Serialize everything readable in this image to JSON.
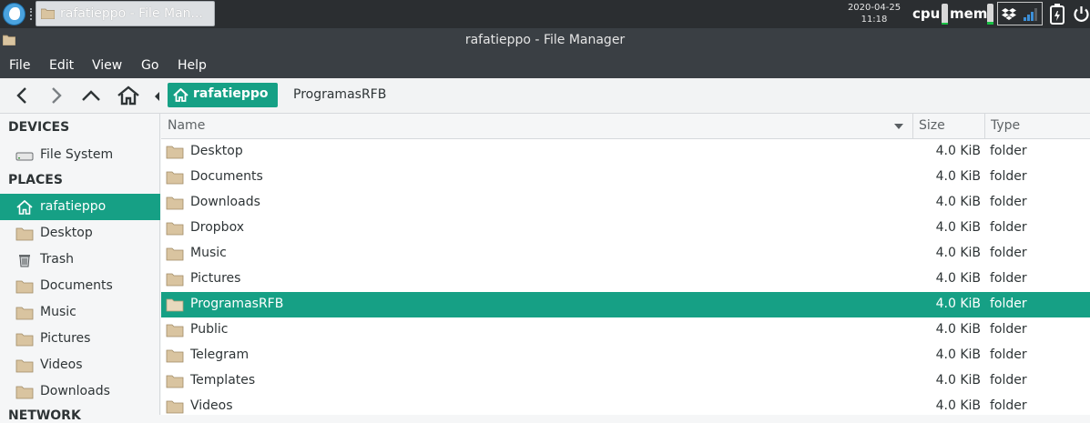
{
  "taskbar": {
    "task_label": "rafatieppo - File Man...",
    "clock_date": "2020-04-25",
    "clock_time": "11:18",
    "cpu_label": "cpu",
    "mem_label": "mem"
  },
  "window": {
    "title": "rafatieppo - File Manager"
  },
  "menu": {
    "items": [
      "File",
      "Edit",
      "View",
      "Go",
      "Help"
    ]
  },
  "path": {
    "home_label": "rafatieppo",
    "current": "ProgramasRFB"
  },
  "sidebar": {
    "devices_heading": "DEVICES",
    "devices": [
      {
        "label": "File System",
        "icon": "drive-icon"
      }
    ],
    "places_heading": "PLACES",
    "places": [
      {
        "label": "rafatieppo",
        "icon": "home-icon"
      },
      {
        "label": "Desktop",
        "icon": "folder-icon"
      },
      {
        "label": "Trash",
        "icon": "trash-icon"
      },
      {
        "label": "Documents",
        "icon": "folder-icon"
      },
      {
        "label": "Music",
        "icon": "folder-icon"
      },
      {
        "label": "Pictures",
        "icon": "folder-icon"
      },
      {
        "label": "Videos",
        "icon": "folder-icon"
      },
      {
        "label": "Downloads",
        "icon": "folder-icon"
      }
    ],
    "network_heading": "NETWORK"
  },
  "list": {
    "columns": {
      "name": "Name",
      "size": "Size",
      "type": "Type"
    },
    "rows": [
      {
        "name": "Desktop",
        "size": "4.0 KiB",
        "type": "folder"
      },
      {
        "name": "Documents",
        "size": "4.0 KiB",
        "type": "folder"
      },
      {
        "name": "Downloads",
        "size": "4.0 KiB",
        "type": "folder"
      },
      {
        "name": "Dropbox",
        "size": "4.0 KiB",
        "type": "folder"
      },
      {
        "name": "Music",
        "size": "4.0 KiB",
        "type": "folder"
      },
      {
        "name": "Pictures",
        "size": "4.0 KiB",
        "type": "folder"
      },
      {
        "name": "ProgramasRFB",
        "size": "4.0 KiB",
        "type": "folder"
      },
      {
        "name": "Public",
        "size": "4.0 KiB",
        "type": "folder"
      },
      {
        "name": "Telegram",
        "size": "4.0 KiB",
        "type": "folder"
      },
      {
        "name": "Templates",
        "size": "4.0 KiB",
        "type": "folder"
      },
      {
        "name": "Videos",
        "size": "4.0 KiB",
        "type": "folder"
      }
    ],
    "selected_row": "ProgramasRFB"
  },
  "colors": {
    "accent": "#16a085",
    "panel": "#2b2e31",
    "titlebar": "#3a3f44",
    "folder": "#d9c4a0"
  }
}
